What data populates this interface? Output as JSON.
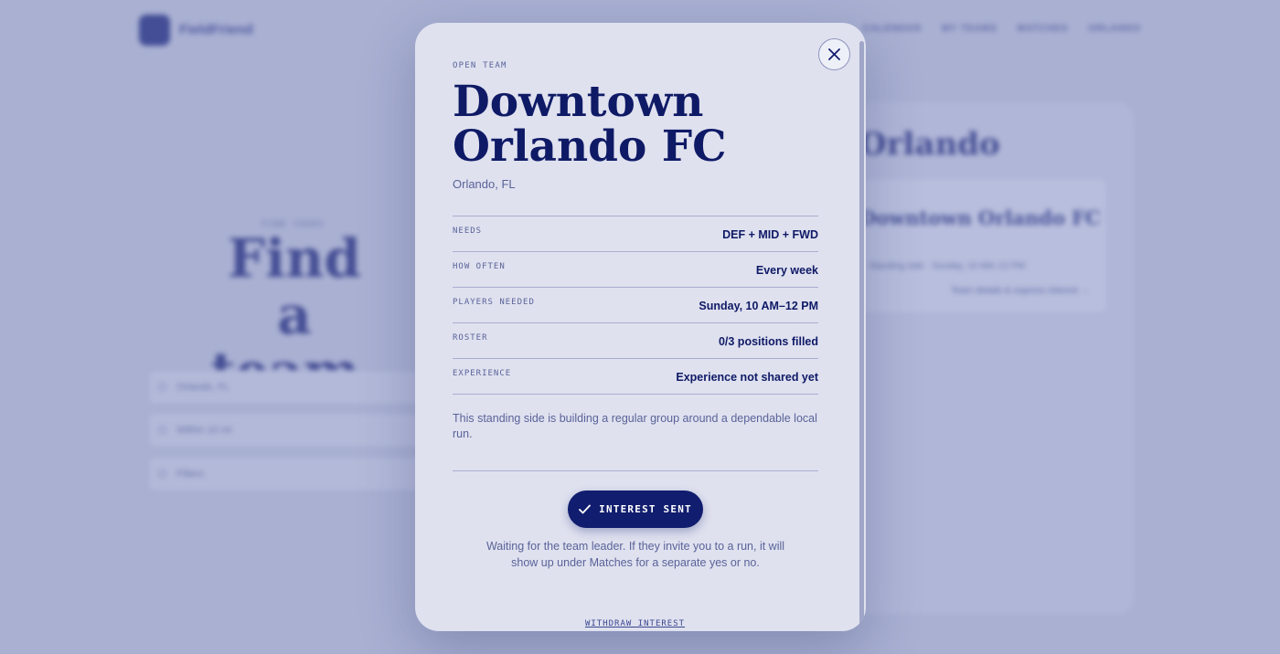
{
  "background": {
    "logo_text": "FieldFriend",
    "nav_links": [
      "CALENDAR",
      "MY TEAMS",
      "MATCHES",
      "ORLANDO"
    ],
    "hero_eyebrow": "FIND YOURS",
    "hero_title": "Find a team.",
    "filters": [
      "Orlando, FL",
      "Within 10 mi",
      "Filters"
    ],
    "panel_title": "Orlando",
    "card_title": "Downtown Orlando FC",
    "card_line": "Standing side · Sunday, 10 AM–12 PM",
    "card_link": "Team details & express interest →"
  },
  "modal": {
    "eyebrow": "OPEN TEAM",
    "title": "Downtown Orlando FC",
    "location": "Orlando, FL",
    "details": [
      {
        "label": "NEEDS",
        "value": "DEF + MID + FWD"
      },
      {
        "label": "HOW OFTEN",
        "value": "Every week"
      },
      {
        "label": "PLAYERS NEEDED",
        "value": "Sunday, 10 AM–12 PM"
      },
      {
        "label": "ROSTER",
        "value": "0/3 positions filled"
      },
      {
        "label": "EXPERIENCE",
        "value": "Experience not shared yet"
      }
    ],
    "description": "This standing side is building a regular group around a dependable local run.",
    "interest_button": "INTEREST SENT",
    "waiting_text": "Waiting for the team leader. If they invite you to a run, it will show up under Matches for a separate yes or no.",
    "withdraw_link": "WITHDRAW INTEREST"
  },
  "icons": {
    "close": "close-icon",
    "check": "check-icon"
  },
  "colors": {
    "accent": "#111d6e",
    "modal_bg": "#dfe1ef",
    "overlay": "#a9b0d2"
  }
}
